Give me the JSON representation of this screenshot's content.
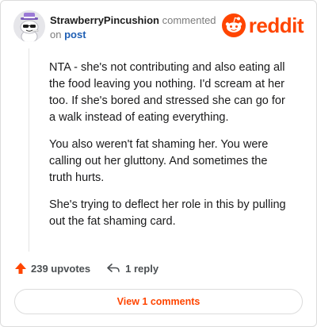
{
  "comment": {
    "username": "StrawberryPincushion",
    "action_text": "commented",
    "on_text": "on",
    "post_link_label": "post",
    "paragraphs": [
      "NTA - she's not contributing and also eating all the food leaving you nothing. I'd scream at her too. If she's bored and stressed she can go for a walk instead of eating everything.",
      "You also weren't fat shaming her. You were calling out her gluttony. And sometimes the truth hurts.",
      "She's trying to deflect her role in this by pulling out the fat shaming card."
    ]
  },
  "brand": {
    "wordmark": "reddit",
    "color": "#ff4500"
  },
  "actions": {
    "upvotes": "239 upvotes",
    "reply": "1 reply",
    "view_comments": "View 1 comments"
  },
  "icons": {
    "avatar": "snoo-avatar-icon",
    "logo": "reddit-snoo-icon",
    "upvote": "upvote-arrow-icon",
    "reply": "reply-arrow-icon"
  }
}
